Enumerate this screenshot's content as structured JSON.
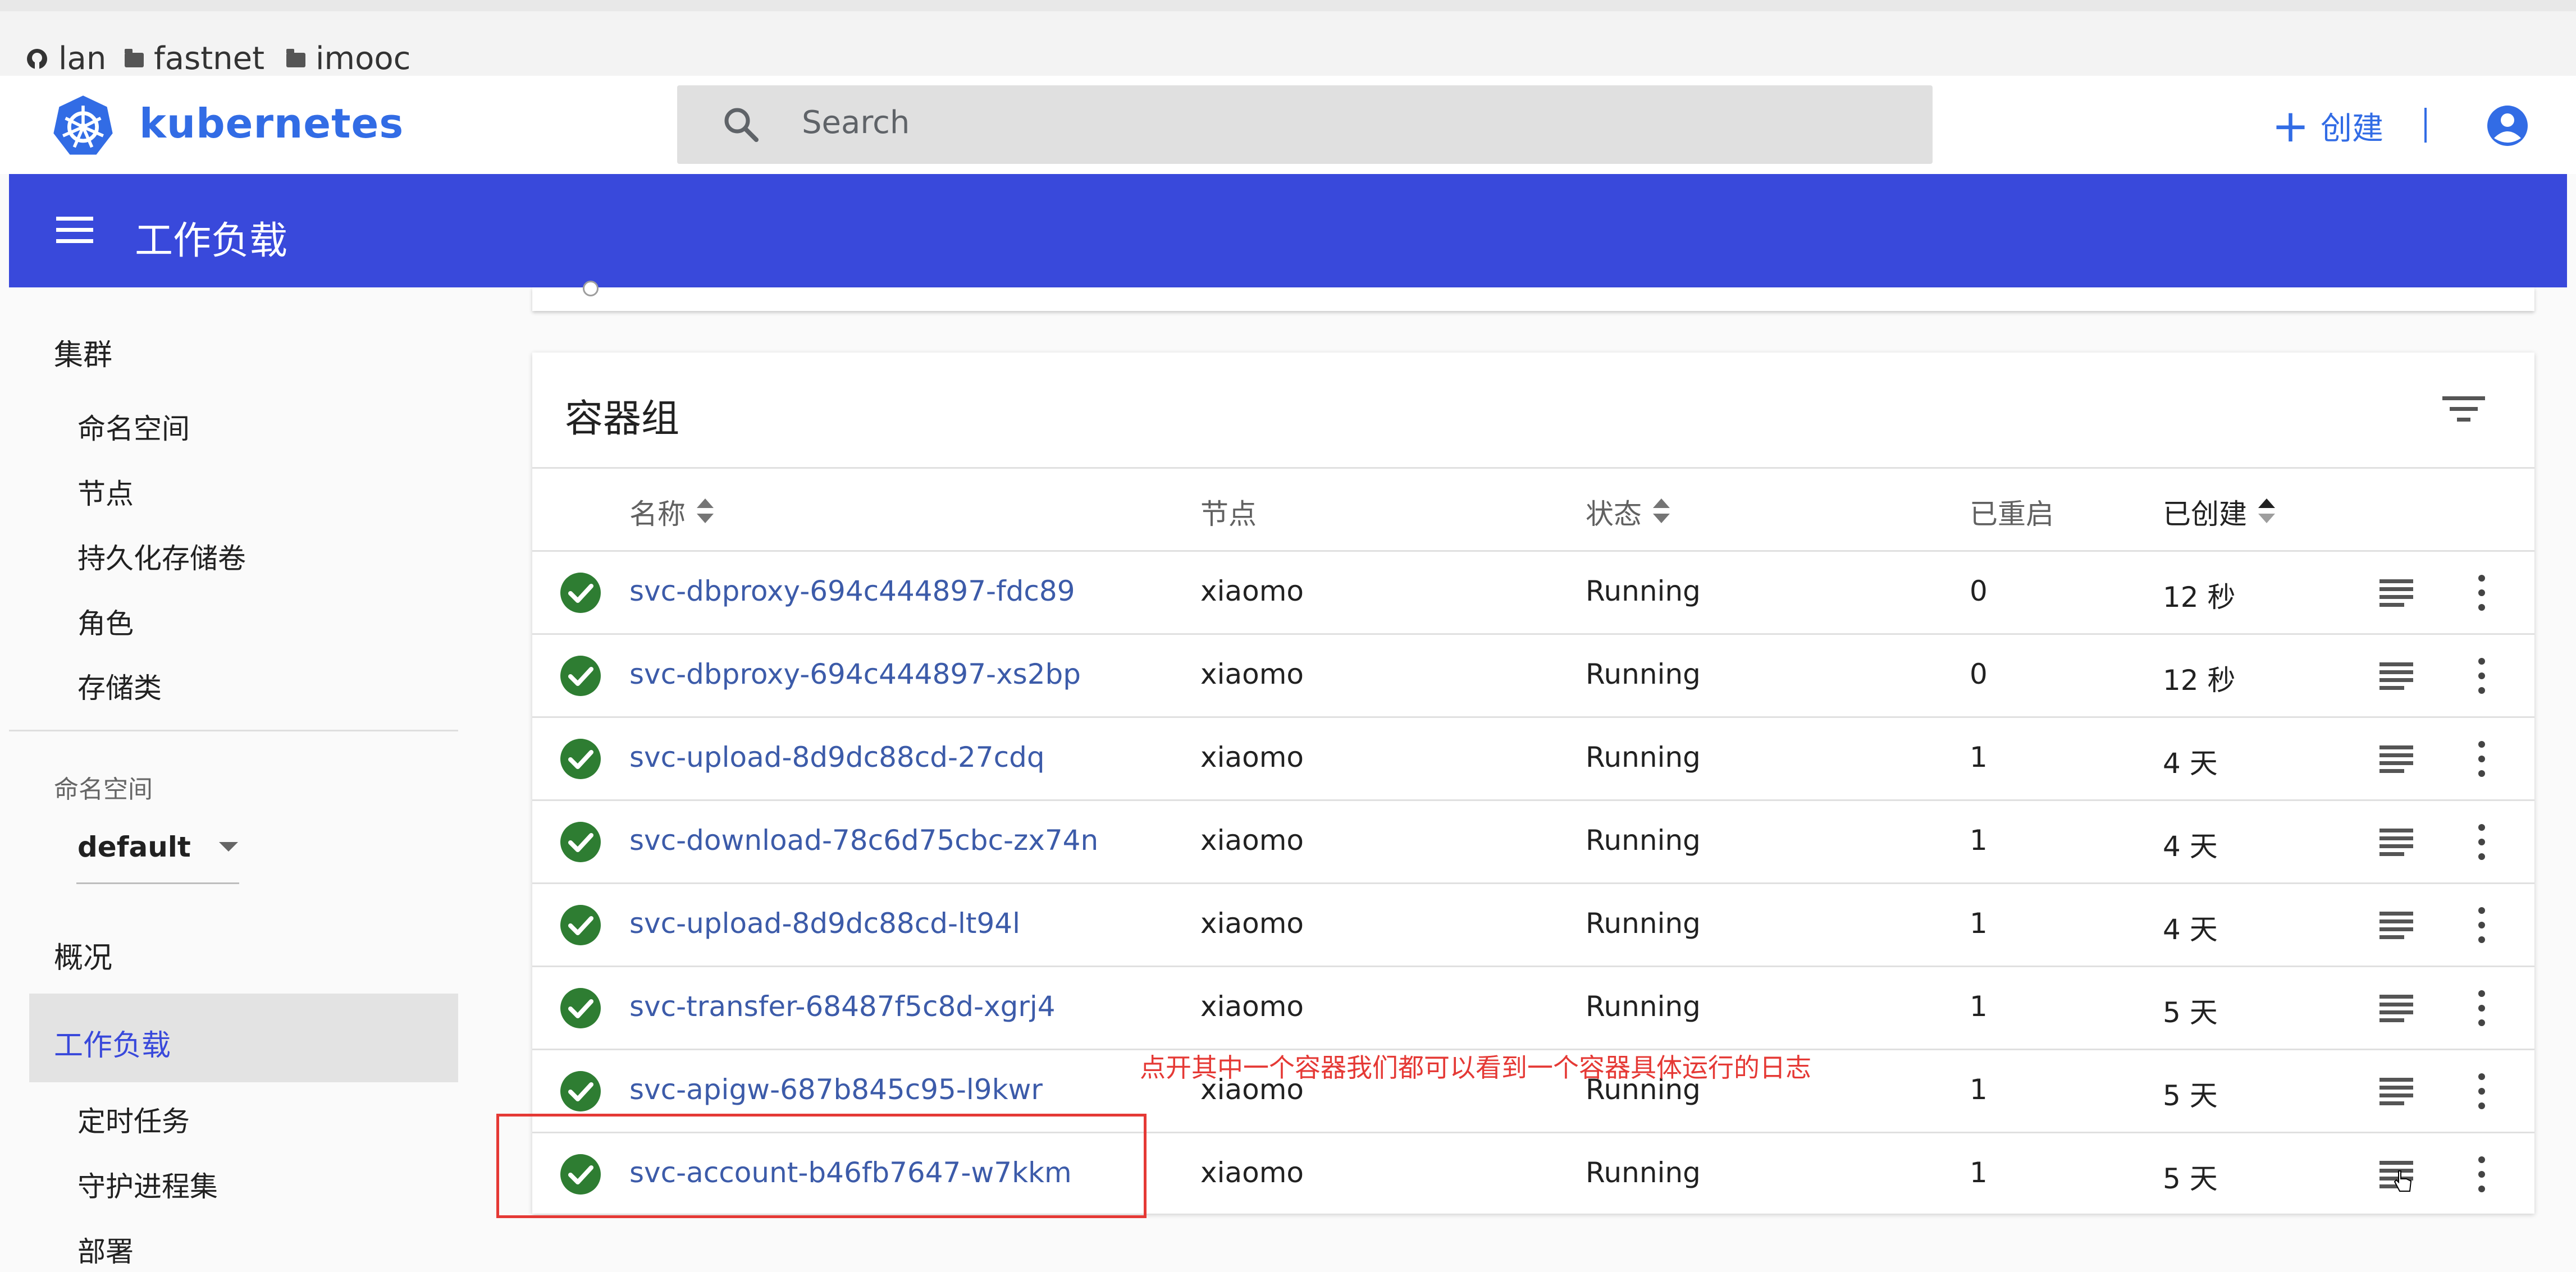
{
  "bookmarks": [
    {
      "label": "lan",
      "icon": "github-icon"
    },
    {
      "label": "fastnet",
      "icon": "folder-icon"
    },
    {
      "label": "imooc",
      "icon": "folder-icon"
    }
  ],
  "brand": {
    "name": "kubernetes",
    "logo": "kubernetes-helm-icon",
    "color": "#326ce5"
  },
  "search": {
    "placeholder": "Search"
  },
  "header": {
    "create_label": "创建",
    "accent": "#3949db"
  },
  "page_title": "工作负载",
  "sidebar": {
    "cluster_heading": "集群",
    "cluster_items": [
      "命名空间",
      "节点",
      "持久化存储卷",
      "角色",
      "存储类"
    ],
    "namespace_label": "命名空间",
    "namespace_value": "default",
    "overview": "概况",
    "workloads": "工作负载",
    "workload_items": [
      "定时任务",
      "守护进程集",
      "部署"
    ]
  },
  "card": {
    "title": "容器组",
    "columns": {
      "name": "名称",
      "node": "节点",
      "status": "状态",
      "restarts": "已重启",
      "created": "已创建"
    }
  },
  "pods": [
    {
      "name": "svc-dbproxy-694c444897-fdc89",
      "node": "xiaomo",
      "status": "Running",
      "restarts": "0",
      "created": "12 秒"
    },
    {
      "name": "svc-dbproxy-694c444897-xs2bp",
      "node": "xiaomo",
      "status": "Running",
      "restarts": "0",
      "created": "12 秒"
    },
    {
      "name": "svc-upload-8d9dc88cd-27cdq",
      "node": "xiaomo",
      "status": "Running",
      "restarts": "1",
      "created": "4 天"
    },
    {
      "name": "svc-download-78c6d75cbc-zx74n",
      "node": "xiaomo",
      "status": "Running",
      "restarts": "1",
      "created": "4 天"
    },
    {
      "name": "svc-upload-8d9dc88cd-lt94l",
      "node": "xiaomo",
      "status": "Running",
      "restarts": "1",
      "created": "4 天"
    },
    {
      "name": "svc-transfer-68487f5c8d-xgrj4",
      "node": "xiaomo",
      "status": "Running",
      "restarts": "1",
      "created": "5 天"
    },
    {
      "name": "svc-apigw-687b845c95-l9kwr",
      "node": "xiaomo",
      "status": "Running",
      "restarts": "1",
      "created": "5 天"
    },
    {
      "name": "svc-account-b46fb7647-w7kkm",
      "node": "xiaomo",
      "status": "Running",
      "restarts": "1",
      "created": "5 天"
    }
  ],
  "annotation": "点开其中一个容器我们都可以看到一个容器具体运行的日志"
}
